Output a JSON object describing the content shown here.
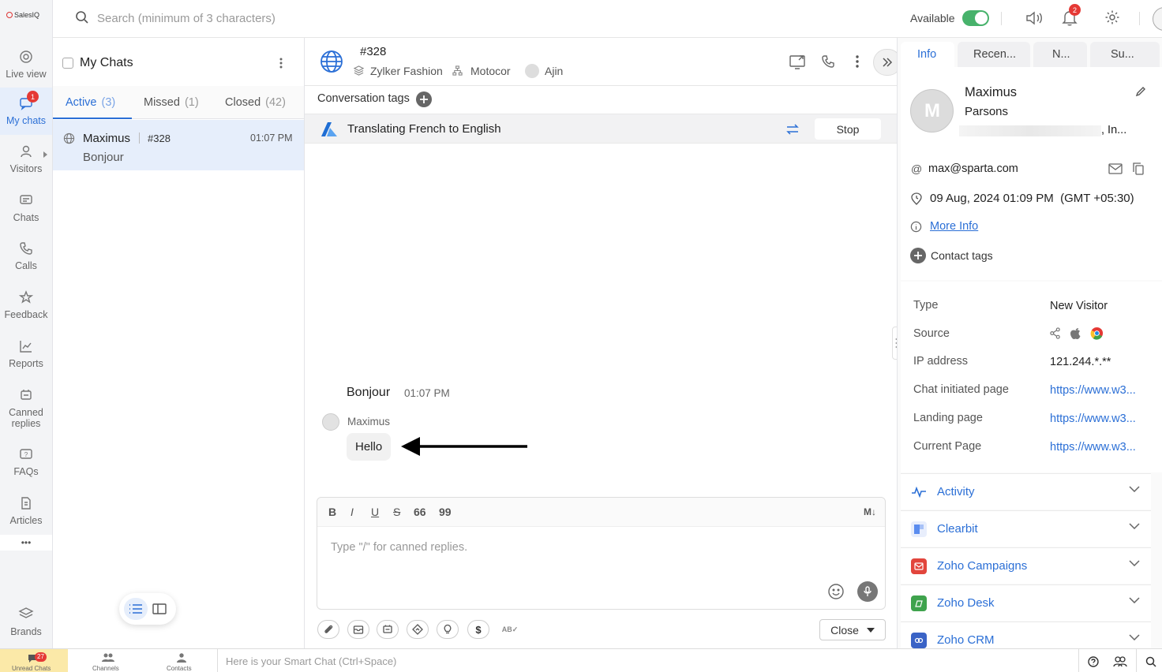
{
  "brand": "SalesIQ",
  "rail": {
    "items": [
      {
        "label": "Live view"
      },
      {
        "label": "My chats",
        "badge": "1"
      },
      {
        "label": "Visitors"
      },
      {
        "label": "Chats"
      },
      {
        "label": "Calls"
      },
      {
        "label": "Feedback"
      },
      {
        "label": "Reports"
      },
      {
        "label": "Canned replies"
      },
      {
        "label": "FAQs"
      },
      {
        "label": "Articles"
      }
    ],
    "more": "•••",
    "brands_label": "Brands"
  },
  "topbar": {
    "search_placeholder": "Search (minimum of 3 characters)",
    "status_label": "Available",
    "notification_count": "2"
  },
  "chatlist": {
    "title": "My Chats",
    "tabs": [
      {
        "label": "Active",
        "count": "(3)"
      },
      {
        "label": "Missed",
        "count": "(1)"
      },
      {
        "label": "Closed",
        "count": "(42)"
      }
    ],
    "rows": [
      {
        "name": "Maximus",
        "id": "#328",
        "time": "01:07 PM",
        "preview": "Bonjour"
      }
    ]
  },
  "conversation": {
    "id": "#328",
    "brand": "Zylker Fashion",
    "department": "Motocor",
    "operator": "Ajin",
    "tags_label": "Conversation tags",
    "translate_text": "Translating French to English",
    "stop_label": "Stop",
    "messages": [
      {
        "text": "Bonjour",
        "time": "01:07 PM"
      },
      {
        "sender": "Maximus",
        "text": "Hello"
      }
    ],
    "editor_placeholder": "Type \"/\" for canned replies.",
    "close_label": "Close",
    "markdown_label": "M↓"
  },
  "info": {
    "tabs": [
      "Info",
      "Recen...",
      "N...",
      "Su..."
    ],
    "first_name": "Maximus",
    "last_name": "Parsons",
    "company_suffix": ", In...",
    "email": "max@sparta.com",
    "datetime": "09 Aug, 2024 01:09 PM  (GMT +05:30)",
    "more_info": "More Info",
    "contact_tags": "Contact tags",
    "details": [
      {
        "label": "Type",
        "value": "New Visitor",
        "link": false
      },
      {
        "label": "Source",
        "value": "",
        "link": false
      },
      {
        "label": "IP address",
        "value": "121.244.*.**",
        "link": false
      },
      {
        "label": "Chat initiated page",
        "value": "https://www.w3...",
        "link": true
      },
      {
        "label": "Landing page",
        "value": "https://www.w3...",
        "link": true
      },
      {
        "label": "Current Page",
        "value": "https://www.w3...",
        "link": true
      }
    ],
    "integrations": [
      {
        "label": "Activity",
        "color": "#ffffff"
      },
      {
        "label": "Clearbit",
        "color": "#e8eefc"
      },
      {
        "label": "Zoho Campaigns",
        "color": "#e2453c"
      },
      {
        "label": "Zoho Desk",
        "color": "#3fa34d"
      },
      {
        "label": "Zoho CRM",
        "color": "#3a63c6"
      }
    ]
  },
  "statusbar": {
    "unread_label": "Unread Chats",
    "unread_count": "27",
    "channels_label": "Channels",
    "contacts_label": "Contacts",
    "smart_chat": "Here is your Smart Chat (Ctrl+Space)"
  },
  "colors": {
    "accent": "#2b6fd6",
    "available": "#47b26b",
    "badge": "#e53935"
  }
}
